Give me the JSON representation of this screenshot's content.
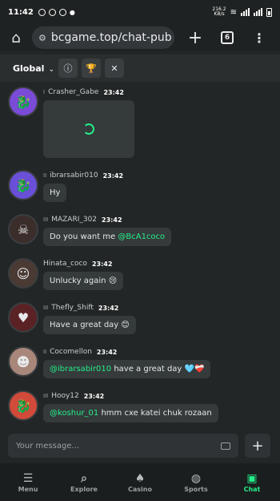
{
  "statusbar": {
    "time": "11:42",
    "net_speed": "216.2",
    "net_unit": "KB/s"
  },
  "browser": {
    "url": "bcgame.top/chat-pub",
    "tab_count": "6"
  },
  "chat": {
    "room": "Global"
  },
  "messages": [
    {
      "user": "Crasher_Gabe",
      "time": "23:42",
      "level": "I",
      "type": "image"
    },
    {
      "user": "ibrarsabir010",
      "time": "23:42",
      "level": "II",
      "text": "Hy"
    },
    {
      "user": "MAZARI_302",
      "time": "23:42",
      "level": "III",
      "pre": "Do you want me ",
      "mention": "@BcA1coco",
      "post": ""
    },
    {
      "user": "Hinata_coco",
      "time": "23:42",
      "level": "",
      "text": "Unlucky again 😢"
    },
    {
      "user": "Thefly_Shift",
      "time": "23:42",
      "level": "III",
      "text": "Have a great day 😊"
    },
    {
      "user": "Cocomellon",
      "time": "23:42",
      "level": "II",
      "pre": "",
      "mention": "@ibrarsabir010",
      "post": " have a great day 🩵❤️‍🩹"
    },
    {
      "user": "Hooy12",
      "time": "23:42",
      "level": "III",
      "pre": "",
      "mention": "@koshur_01",
      "post": " hmm cxe katei chuk rozaan"
    }
  ],
  "composer": {
    "placeholder": "Your message..."
  },
  "nav": [
    {
      "label": "Menu",
      "icon": "menu-icon"
    },
    {
      "label": "Explore",
      "icon": "explore-icon"
    },
    {
      "label": "Casino",
      "icon": "casino-icon"
    },
    {
      "label": "Sports",
      "icon": "sports-icon"
    },
    {
      "label": "Chat",
      "icon": "chat-icon"
    }
  ],
  "colors": {
    "accent": "#24ee89",
    "background": "#232626",
    "bubble": "#353a3b"
  }
}
